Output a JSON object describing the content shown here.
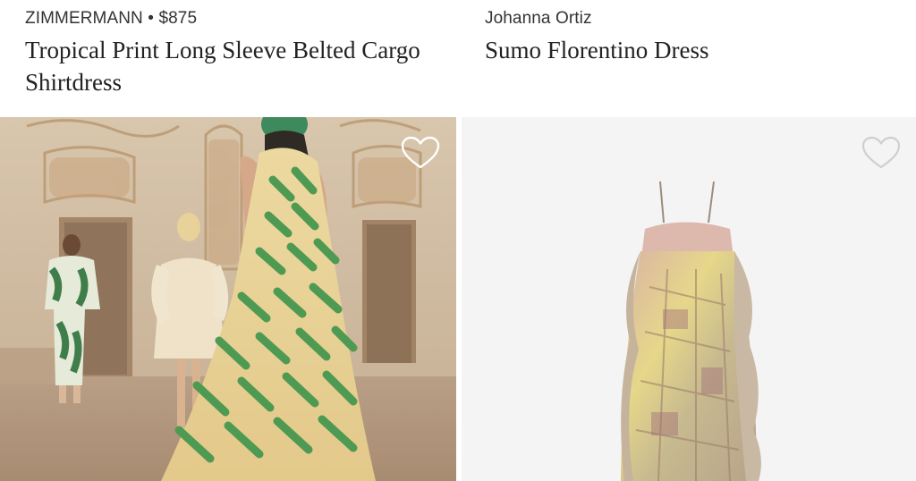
{
  "products": [
    {
      "brand": "ZIMMERMANN",
      "separator": "•",
      "price": "$875",
      "title": "Tropical Print Long Sleeve Belted Cargo Shirtdress",
      "favorite_icon": "heart-outline-icon"
    },
    {
      "brand": "Johanna Ortiz",
      "title": "Sumo Florentino Dress",
      "favorite_icon": "heart-outline-icon"
    }
  ],
  "colors": {
    "text_primary": "#222222",
    "text_secondary": "#333333",
    "image_bg_right": "#f4f4f4",
    "heart_left": "#ffffff",
    "heart_right": "#cfcfcf"
  }
}
